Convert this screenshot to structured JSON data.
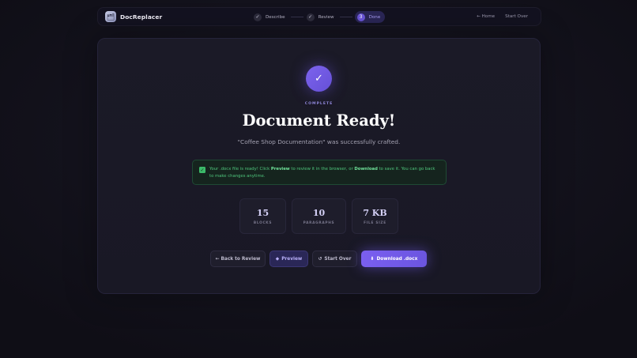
{
  "app": {
    "name": "DocReplacer",
    "logo_glyph": "🗂"
  },
  "steps": [
    {
      "label": "Describe",
      "marker": "✓"
    },
    {
      "label": "Review",
      "marker": "✓"
    },
    {
      "label": "Done",
      "marker": "3"
    }
  ],
  "nav": {
    "home": "← Home",
    "start_over": "Start Over"
  },
  "status": {
    "icon_glyph": "✓",
    "eyebrow": "COMPLETE",
    "title": "Document Ready!",
    "subtitle": "\"Coffee Shop Documentation\" was successfully crafted."
  },
  "notice": {
    "icon_glyph": "✓",
    "part1": "Your .docx file is ready! Click ",
    "preview_word": "Preview",
    "part2": " to review it in the browser, or ",
    "download_word": "Download",
    "part3": " to save it. You can go back to make changes anytime."
  },
  "stats": [
    {
      "value": "15",
      "label": "BLOCKS"
    },
    {
      "value": "10",
      "label": "PARAGRAPHS"
    },
    {
      "value": "7 KB",
      "label": "FILE SIZE"
    }
  ],
  "actions": {
    "back": "← Back to Review",
    "preview_icon": "◆",
    "preview": "Preview",
    "start_over_icon": "↺",
    "start_over": "Start Over",
    "download_icon": "⬇",
    "download": "Download .docx"
  },
  "colors": {
    "accent": "#6b56d8",
    "success": "#4fc77d",
    "background": "#100f18"
  }
}
